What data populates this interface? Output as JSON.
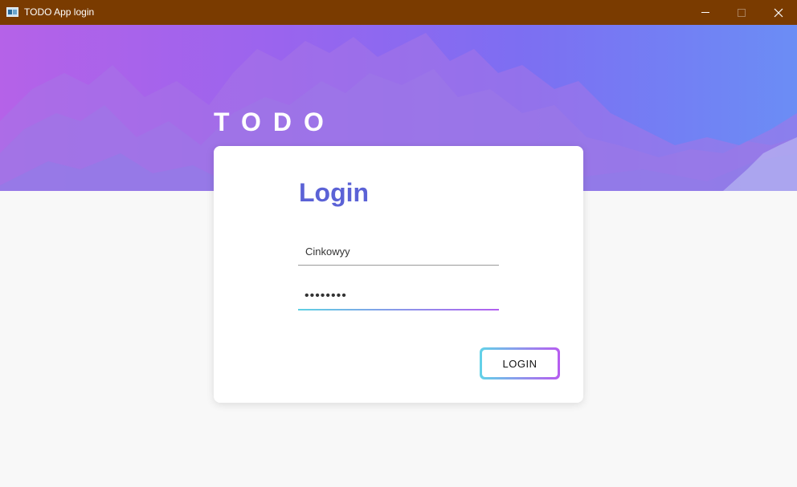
{
  "window": {
    "title": "TODO App login",
    "minimize_icon": "minimize-icon",
    "maximize_icon": "maximize-icon",
    "close_icon": "close-icon"
  },
  "hero": {
    "brand": "TODO",
    "gradient_start": "#b562e8",
    "gradient_end": "#6b8df5"
  },
  "login_form": {
    "title": "Login",
    "username_value": "Cinkowyy",
    "password_value": "••••••••",
    "submit_label": "LOGIN",
    "accent_color": "#5b62d6"
  }
}
